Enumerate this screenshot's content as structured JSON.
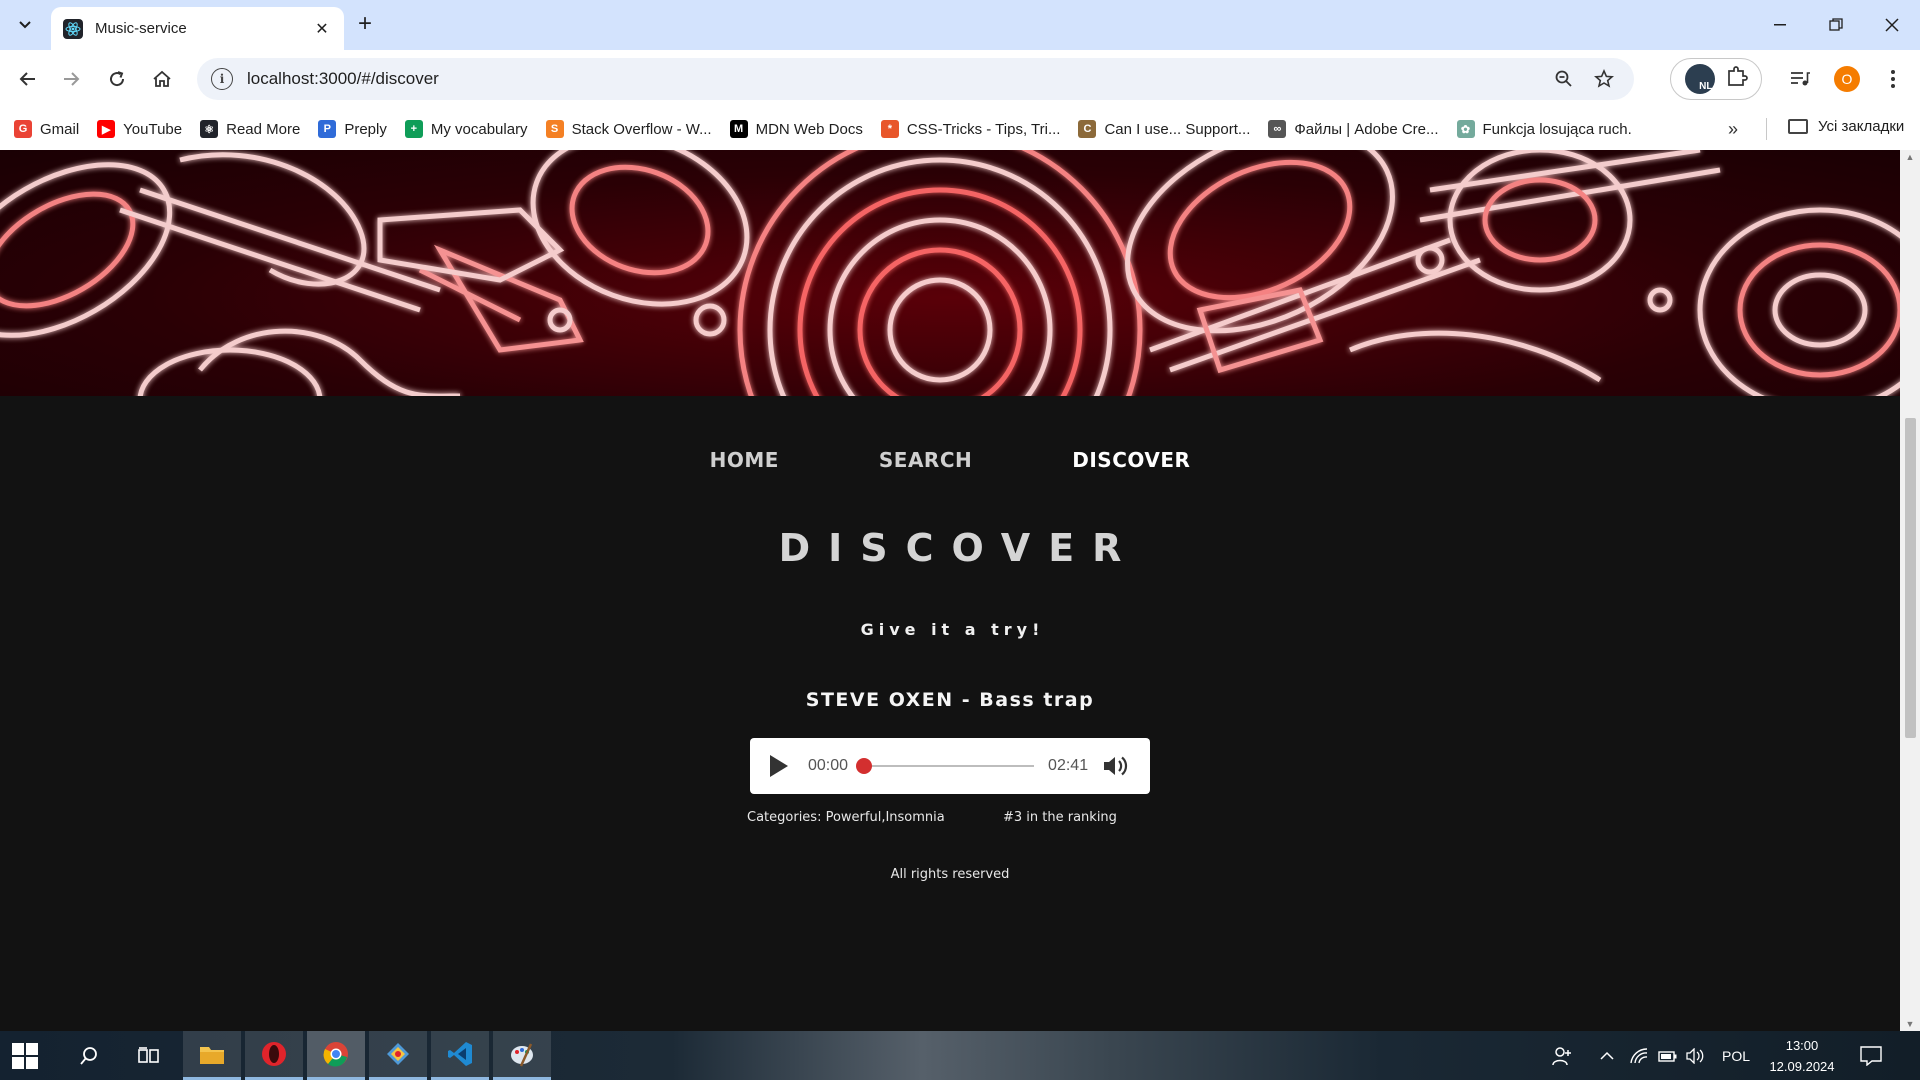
{
  "browser": {
    "tab_title": "Music-service",
    "url": "localhost:3000/#/discover",
    "profile_initial": "O",
    "vpn_badge": "NL",
    "bookmarks": [
      {
        "label": "Gmail",
        "icon": "gmail-icon",
        "color": "#ea4335"
      },
      {
        "label": "YouTube",
        "icon": "youtube-icon",
        "color": "#ff0000"
      },
      {
        "label": "Read More",
        "icon": "react-icon",
        "color": "#20232a"
      },
      {
        "label": "Preply",
        "icon": "preply-icon",
        "color": "#2f6bd8"
      },
      {
        "label": "My vocabulary",
        "icon": "sheets-icon",
        "color": "#0f9d58"
      },
      {
        "label": "Stack Overflow - W...",
        "icon": "stackoverflow-icon",
        "color": "#f48024"
      },
      {
        "label": "MDN Web Docs",
        "icon": "mdn-icon",
        "color": "#000000"
      },
      {
        "label": "CSS-Tricks - Tips, Tri...",
        "icon": "csstricks-icon",
        "color": "#e8562a"
      },
      {
        "label": "Can I use... Support...",
        "icon": "caniuse-icon",
        "color": "#8c6a3a"
      },
      {
        "label": "Файлы | Adobe Cre...",
        "icon": "adobe-cc-icon",
        "color": "#555555"
      },
      {
        "label": "Funkcja losująca ruch.",
        "icon": "chatgpt-icon",
        "color": "#74aa9c"
      }
    ],
    "all_bookmarks_label": "Усі закладки"
  },
  "page": {
    "nav": [
      {
        "label": "HOME",
        "active": false
      },
      {
        "label": "SEARCH",
        "active": false
      },
      {
        "label": "DISCOVER",
        "active": true
      }
    ],
    "heading": "DISCOVER",
    "tagline": "Give it a try!",
    "track_title": "STEVE OXEN - Bass trap",
    "player": {
      "current_time": "00:00",
      "duration": "02:41",
      "progress": 0
    },
    "categories": "Categories: Powerful,Insomnia",
    "ranking": "#3 in the ranking",
    "footer": "All rights reserved"
  },
  "taskbar": {
    "language": "POL",
    "time": "13:00",
    "date": "12.09.2024"
  },
  "colors": {
    "page_bg": "#121212",
    "accent_red": "#d32f2f",
    "tab_strip": "#d3e3fd"
  }
}
